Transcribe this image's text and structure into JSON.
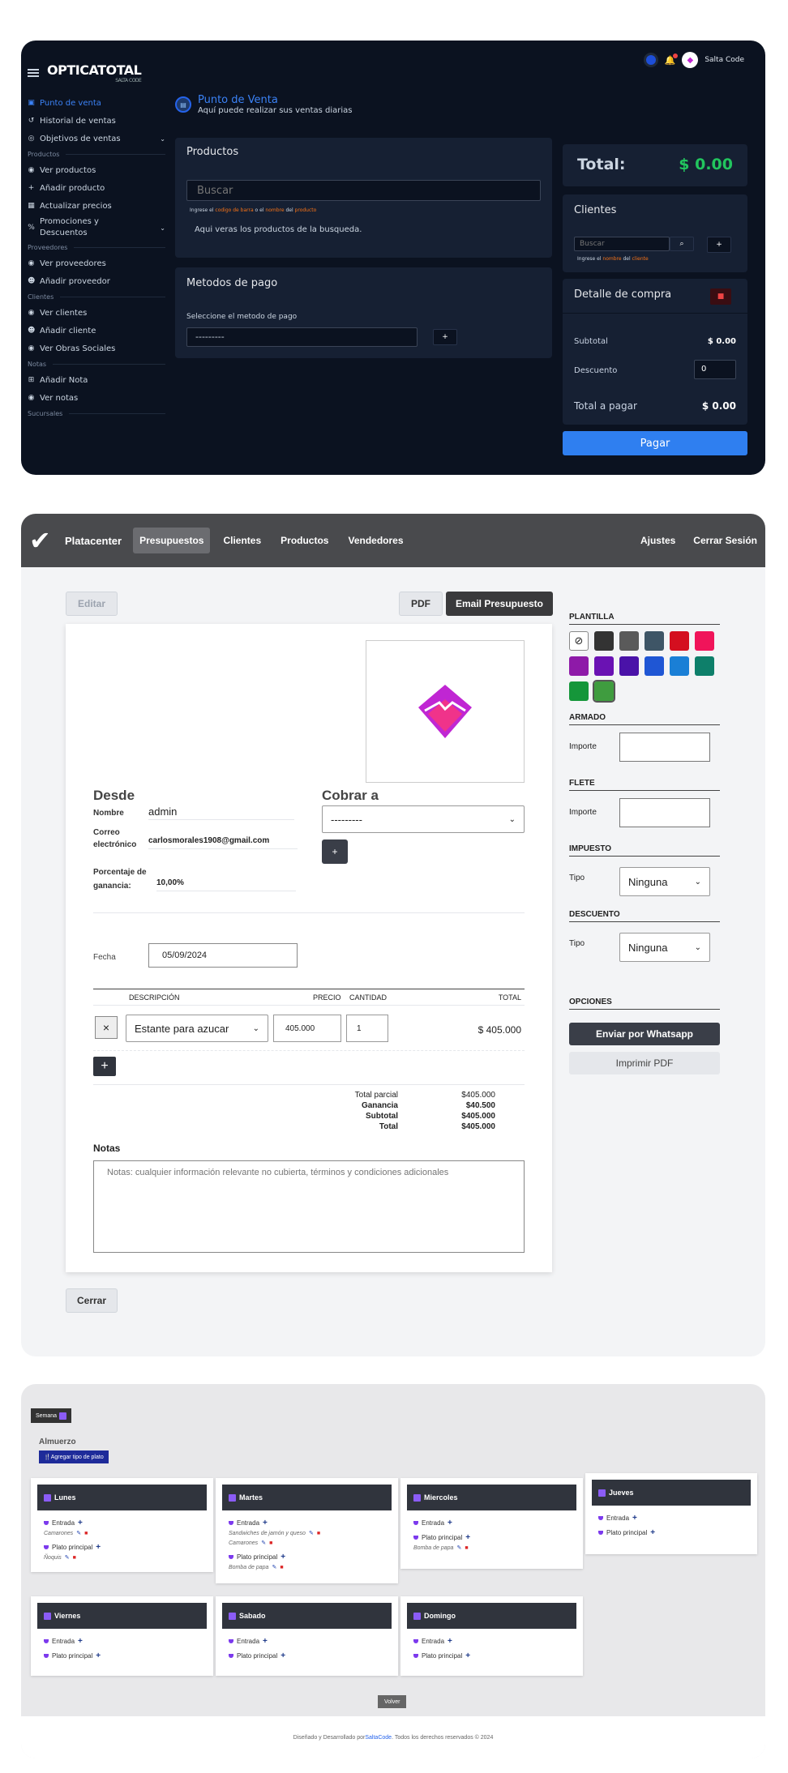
{
  "s1": {
    "logo": "OPTICATOTAL",
    "logo_sub": "SALTA CODE",
    "user": "Salta Code",
    "sidebar": [
      {
        "type": "item",
        "label": "Punto de venta",
        "icon": "cart-icon",
        "active": true
      },
      {
        "type": "item",
        "label": "Historial de ventas",
        "icon": "history-icon"
      },
      {
        "type": "item",
        "label": "Objetivos de ventas",
        "icon": "target-icon",
        "chevron": true
      },
      {
        "type": "section",
        "label": "Productos"
      },
      {
        "type": "item",
        "label": "Ver productos",
        "icon": "eye-icon"
      },
      {
        "type": "item",
        "label": "Añadir producto",
        "icon": "plus-icon"
      },
      {
        "type": "item",
        "label": "Actualizar precios",
        "icon": "table-icon"
      },
      {
        "type": "item",
        "label": "Promociones y Descuentos",
        "icon": "percent-icon",
        "chevron": true
      },
      {
        "type": "section",
        "label": "Proveedores"
      },
      {
        "type": "item",
        "label": "Ver proveedores",
        "icon": "eye-icon"
      },
      {
        "type": "item",
        "label": "Añadir proveedor",
        "icon": "user-plus-icon"
      },
      {
        "type": "section",
        "label": "Clientes"
      },
      {
        "type": "item",
        "label": "Ver clientes",
        "icon": "eye-icon"
      },
      {
        "type": "item",
        "label": "Añadir cliente",
        "icon": "user-plus-icon"
      },
      {
        "type": "item",
        "label": "Ver Obras Sociales",
        "icon": "eye-icon"
      },
      {
        "type": "section",
        "label": "Notas"
      },
      {
        "type": "item",
        "label": "Añadir Nota",
        "icon": "plus-square-icon"
      },
      {
        "type": "item",
        "label": "Ver notas",
        "icon": "eye-icon"
      },
      {
        "type": "section",
        "label": "Sucursales"
      }
    ],
    "page_title": "Punto de Venta",
    "page_subtitle": "Aquí puede realizar sus ventas diarias",
    "productos": {
      "title": "Productos",
      "search_placeholder": "Buscar",
      "hint_a": "Ingrese el ",
      "hint_b": "codigo de barra",
      "hint_c": " o el ",
      "hint_d": "nombre",
      "hint_e": " del ",
      "hint_f": "producto",
      "empty": "Aqui veras los productos de la busqueda."
    },
    "pago": {
      "title": "Metodos de pago",
      "label": "Seleccione el metodo de pago",
      "selected": "---------",
      "add": "+"
    },
    "total": {
      "label": "Total:",
      "value": "$ 0.00"
    },
    "clientes": {
      "title": "Clientes",
      "search_placeholder": "Buscar",
      "add": "+",
      "hint_a": "Ingrese el ",
      "hint_b": "nombre",
      "hint_c": " del ",
      "hint_d": "cliente"
    },
    "detalle": {
      "title": "Detalle de compra",
      "subtotal_label": "Subtotal",
      "subtotal": "$ 0.00",
      "descuento_label": "Descuento",
      "descuento": "0",
      "total_label": "Total a pagar",
      "total": "$ 0.00"
    },
    "pay_button": "Pagar"
  },
  "s2": {
    "brand": "Platacenter",
    "nav": [
      "Presupuestos",
      "Clientes",
      "Productos",
      "Vendedores"
    ],
    "nav_right": [
      "Ajustes",
      "Cerrar Sesión"
    ],
    "edit": "Editar",
    "pdf": "PDF",
    "email": "Email Presupuesto",
    "desde": "Desde",
    "nombre_label": "Nombre",
    "nombre": "admin",
    "correo_label": "Correo electrónico",
    "correo": "carlosmorales1908@gmail.com",
    "ganancia_label": "Porcentaje de ganancia:",
    "ganancia": "10,00%",
    "cobrar": "Cobrar a",
    "cobrar_select": "---------",
    "fecha_label": "Fecha",
    "fecha": "05/09/2024",
    "table_headers": [
      "DESCRIPCIÓN",
      "PRECIO",
      "CANTIDAD",
      "TOTAL"
    ],
    "row": {
      "desc": "Estante para azucar",
      "precio": "405.000",
      "cantidad": "1",
      "total": "$ 405.000"
    },
    "totals": [
      {
        "label": "Total parcial",
        "value": "$405.000",
        "bold": false
      },
      {
        "label": "Ganancia",
        "value": "$40.500",
        "bold": true
      },
      {
        "label": "Subtotal",
        "value": "$405.000",
        "bold": true
      },
      {
        "label": "Total",
        "value": "$405.000",
        "bold": true
      }
    ],
    "notas_label": "Notas",
    "notas_placeholder": "Notas: cualquier información relevante no cubierta, términos y condiciones adicionales",
    "cerrar": "Cerrar",
    "plantilla": "PLANTILLA",
    "swatches": [
      "#333333",
      "#5a5a5a",
      "#3e5566",
      "#d40f1f",
      "#f0145a",
      "#8e1aa8",
      "#6a12b3",
      "#4a12a8",
      "#1f56d4",
      "#1a7fd6",
      "#0e7f6a",
      "#15963a",
      "#3f9c3f"
    ],
    "armado": "ARMADO",
    "flete": "FLETE",
    "importe": "Importe",
    "impuesto": "IMPUESTO",
    "descuento": "DESCUENTO",
    "tipo": "Tipo",
    "ninguna": "Ninguna",
    "opciones": "OPCIONES",
    "whatsapp": "Enviar por Whatsapp",
    "imprimir": "Imprimir PDF"
  },
  "s3": {
    "semana": "Semana",
    "almuerzo": "Almuerzo",
    "agregar": "Agregar tipo de plato",
    "days": [
      {
        "name": "Lunes",
        "items": [
          {
            "label": "Entrada",
            "subs": [
              "Camarones"
            ]
          },
          {
            "label": "Plato principal",
            "subs": [
              "Ñoquis"
            ]
          }
        ]
      },
      {
        "name": "Martes",
        "items": [
          {
            "label": "Entrada",
            "subs": [
              "Sandwiches de jamón y queso",
              "Camarones"
            ]
          },
          {
            "label": "Plato principal",
            "subs": [
              "Bomba de papa"
            ]
          }
        ]
      },
      {
        "name": "Miercoles",
        "items": [
          {
            "label": "Entrada",
            "subs": []
          },
          {
            "label": "Plato principal",
            "subs": [
              "Bomba de papa"
            ]
          }
        ]
      },
      {
        "name": "Jueves",
        "items": [
          {
            "label": "Entrada",
            "subs": []
          },
          {
            "label": "Plato principal",
            "subs": []
          }
        ]
      },
      {
        "name": "Viernes",
        "items": [
          {
            "label": "Entrada",
            "subs": []
          },
          {
            "label": "Plato principal",
            "subs": []
          }
        ]
      },
      {
        "name": "Sabado",
        "items": [
          {
            "label": "Entrada",
            "subs": []
          },
          {
            "label": "Plato principal",
            "subs": []
          }
        ]
      },
      {
        "name": "Domingo",
        "items": [
          {
            "label": "Entrada",
            "subs": []
          },
          {
            "label": "Plato principal",
            "subs": []
          }
        ]
      }
    ],
    "volver": "Volver",
    "footer_a": "Diseñado y Desarrollado por ",
    "footer_b": "SaltaCode",
    "footer_c": ". Todos los derechos reservados © 2024"
  }
}
